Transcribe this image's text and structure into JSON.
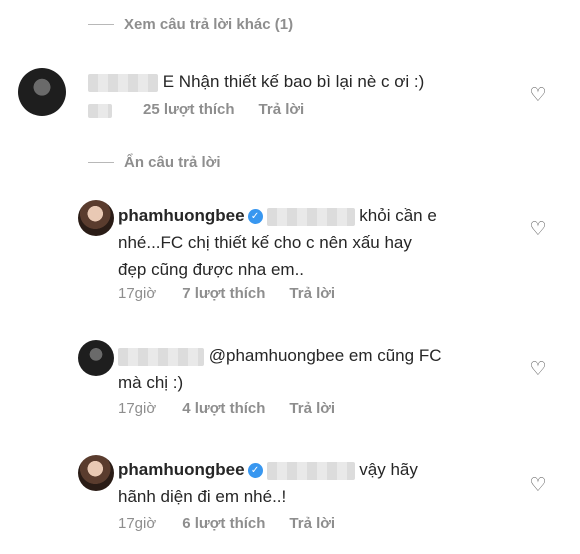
{
  "view_more_replies": "Xem câu trả lời khác (1)",
  "hide_replies": "Ẩn câu trả lời",
  "comments": [
    {
      "text": "E Nhận thiết kế bao bì lại nè c ơi :)",
      "likes": "25 lượt thích",
      "reply_label": "Trả lời"
    },
    {
      "username": "phamhuongbee",
      "text_line1": "khỏi cần e",
      "text_line2": "nhé...FC chị thiết kế cho c nên xấu hay",
      "text_line3": "đẹp cũng được nha em..",
      "time": "17giờ",
      "likes": "7 lượt thích",
      "reply_label": "Trả lời"
    },
    {
      "mention": "@phamhuongbee",
      "text_line1": "em cũng FC",
      "text_line2": "mà chị :)",
      "time": "17giờ",
      "likes": "4 lượt thích",
      "reply_label": "Trả lời"
    },
    {
      "username": "phamhuongbee",
      "text_line1": "vậy hãy",
      "text_line2": "hãnh diện đi em nhé..!",
      "time": "17giờ",
      "likes": "6 lượt thích",
      "reply_label": "Trả lời"
    }
  ],
  "icons": {
    "heart": "heart-outline-icon",
    "verified": "verified-badge-icon"
  },
  "colors": {
    "primary_text": "#262626",
    "secondary_text": "#8e8e8e",
    "verified_blue": "#3897f0"
  }
}
